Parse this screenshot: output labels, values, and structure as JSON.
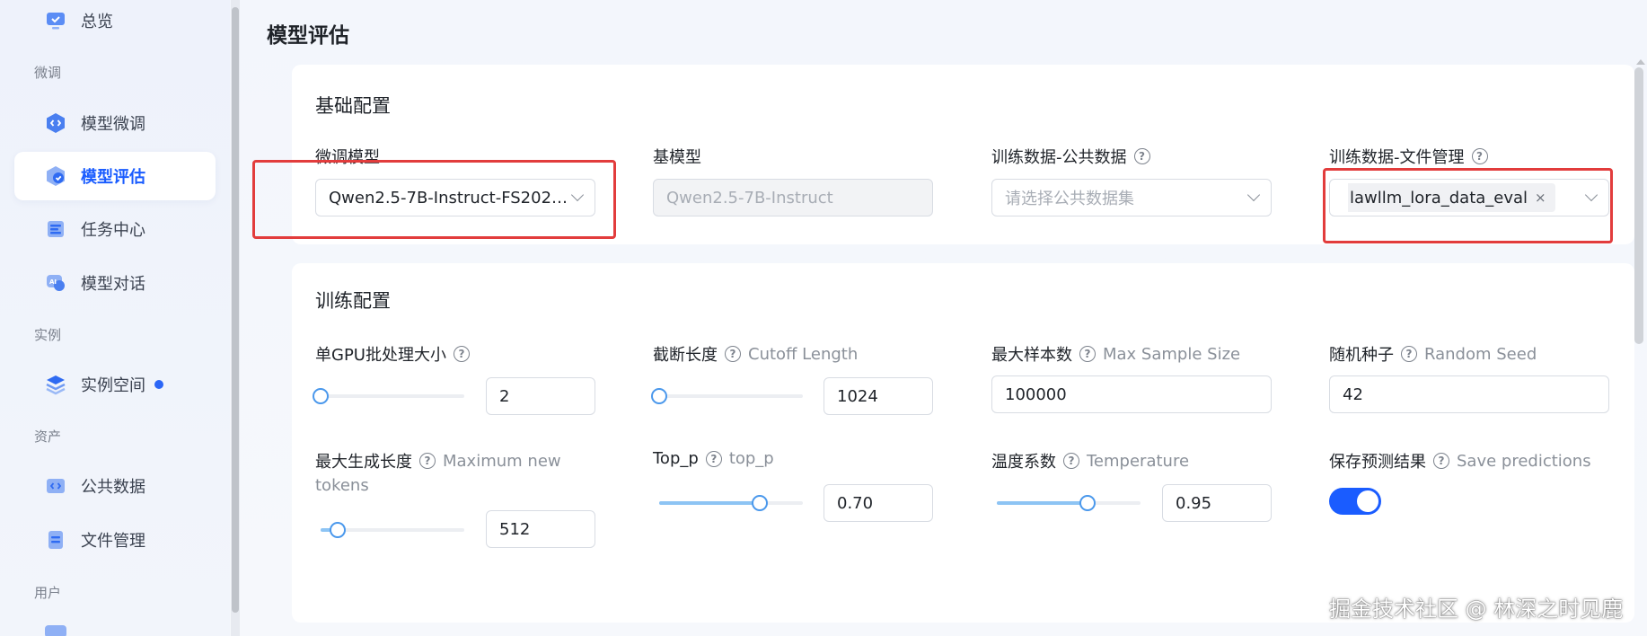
{
  "sidebar": {
    "top_item": {
      "label": "总览"
    },
    "groups": [
      {
        "label": "微调"
      },
      {
        "label": "实例"
      },
      {
        "label": "资产"
      },
      {
        "label": "用户"
      }
    ],
    "items": [
      {
        "label": "模型微调"
      },
      {
        "label": "模型评估",
        "active": true
      },
      {
        "label": "任务中心"
      },
      {
        "label": "模型对话"
      },
      {
        "label": "实例空间",
        "badge": "dot"
      },
      {
        "label": "公共数据"
      },
      {
        "label": "文件管理"
      }
    ]
  },
  "page": {
    "title": "模型评估"
  },
  "basic": {
    "title": "基础配置",
    "finetune_model": {
      "label": "微调模型",
      "value": "Qwen2.5-7B-Instruct-FS2025..."
    },
    "base_model": {
      "label": "基模型",
      "value": "Qwen2.5-7B-Instruct"
    },
    "public_data": {
      "label": "训练数据-公共数据",
      "placeholder": "请选择公共数据集"
    },
    "file_data": {
      "label": "训练数据-文件管理",
      "tag": "lawllm_lora_data_eval",
      "tag_close": "×"
    }
  },
  "train": {
    "title": "训练配置",
    "batch_size": {
      "label": "单GPU批处理大小",
      "value": "2",
      "slider_fraction": 0.0
    },
    "cutoff": {
      "label": "截断长度",
      "en": "Cutoff Length",
      "value": "1024",
      "slider_fraction": 0.0
    },
    "max_samples": {
      "label": "最大样本数",
      "en": "Max Sample Size",
      "value": "100000"
    },
    "seed": {
      "label": "随机种子",
      "en": "Random Seed",
      "value": "42"
    },
    "max_new_tokens": {
      "label": "最大生成长度",
      "en1": "Maximum new",
      "en2": "tokens",
      "value": "512",
      "slider_fraction": 0.12
    },
    "top_p": {
      "label": "Top_p",
      "en": "top_p",
      "value": "0.70",
      "slider_fraction": 0.7
    },
    "temperature": {
      "label": "温度系数",
      "en": "Temperature",
      "value": "0.95",
      "slider_fraction": 0.63
    },
    "save_predictions": {
      "label": "保存预测结果",
      "en": "Save predictions",
      "on": true
    }
  },
  "help_glyph": "?",
  "watermark": "掘金技术社区 @ 林深之时见鹿",
  "colors": {
    "accent": "#1a5cff",
    "highlight_box": "#e23c3c",
    "slider": "#4a98ec"
  }
}
